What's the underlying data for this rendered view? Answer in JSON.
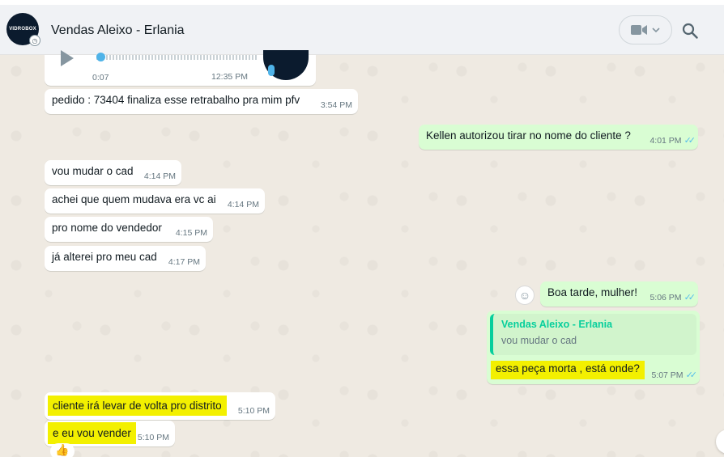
{
  "header": {
    "contact_name": "Vendas Aleixo - Erlania",
    "avatar_brand": "VIDROBOX",
    "icons": {
      "video": "video-camera-icon",
      "dropdown": "chevron-down-icon",
      "search": "search-icon"
    }
  },
  "voice_message": {
    "duration": "0:07",
    "time": "12:35 PM"
  },
  "messages": [
    {
      "direction": "in",
      "text": "pedido : 73404  finaliza esse retrabalho pra mim pfv",
      "time": "3:54 PM"
    },
    {
      "direction": "out",
      "text": "Kellen autorizou tirar no nome do cliente ?",
      "time": "4:01 PM",
      "read": true
    },
    {
      "direction": "in",
      "text": "vou mudar o cad",
      "time": "4:14 PM"
    },
    {
      "direction": "in",
      "text": "achei que quem mudava era vc ai",
      "time": "4:14 PM"
    },
    {
      "direction": "in",
      "text": "pro nome do vendedor",
      "time": "4:15 PM"
    },
    {
      "direction": "in",
      "text": "já alterei pro meu cad",
      "time": "4:17 PM"
    },
    {
      "direction": "out",
      "text": "Boa tarde, mulher!",
      "time": "5:06 PM",
      "read": true
    },
    {
      "direction": "out",
      "quote": {
        "author": "Vendas Aleixo - Erlania",
        "text": "vou mudar o cad"
      },
      "text": "essa peça morta , está onde?",
      "time": "5:07 PM",
      "read": true,
      "highlighted": true
    },
    {
      "direction": "in",
      "text": "cliente irá levar de volta pro distrito",
      "time": "5:10 PM",
      "highlighted": true
    },
    {
      "direction": "in",
      "text": "e eu vou vender",
      "time": "5:10 PM",
      "highlighted": true
    }
  ],
  "ticks": "✓✓",
  "colors": {
    "wallpaper": "#efeae2",
    "outgoing": "#d9fdd3",
    "incoming": "#ffffff",
    "quote_accent": "#06cf9c",
    "read_ticks": "#53bdeb",
    "highlight": "#f3f000"
  }
}
